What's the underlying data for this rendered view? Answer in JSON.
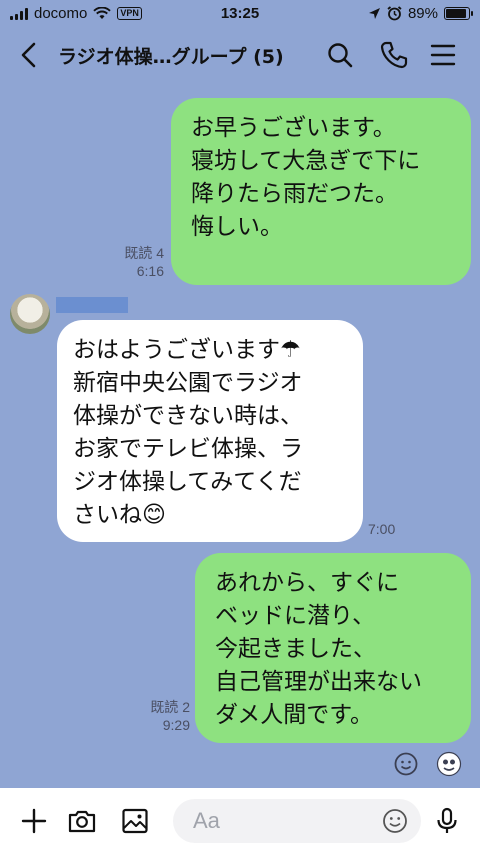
{
  "status": {
    "carrier": "docomo",
    "vpn": "VPN",
    "time": "13:25",
    "battery_pct": "89%",
    "battery_level": 0.89
  },
  "header": {
    "title": "ラジオ体操…グループ (5)"
  },
  "messages": [
    {
      "side": "me",
      "text": "お早うございます。\n寝坊して大急ぎで下に\n降りたら雨だつた。\n悔しい。",
      "read": "既読 4",
      "time": "6:16"
    },
    {
      "side": "other",
      "text": "おはようございます☂\n新宿中央公園でラジオ\n体操ができない時は、\nお家でテレビ体操、ラ\nジオ体操してみてくだ\nさいね😊",
      "time": "7:00"
    },
    {
      "side": "me",
      "text": "あれから、すぐに\nベッドに潜り、\n今起きました、\n自己管理が出来ない\nダメ人間です。",
      "read": "既読 2",
      "time": "9:29"
    }
  ],
  "input": {
    "placeholder": "Aa"
  },
  "icons": {
    "back": "chevron-left-icon",
    "search": "search-icon",
    "call": "phone-icon",
    "menu": "menu-icon",
    "add": "plus-icon",
    "camera": "camera-icon",
    "image": "image-icon",
    "emoji": "emoji-icon",
    "mic": "microphone-icon"
  },
  "colors": {
    "background": "#8fa5d3",
    "my_bubble": "#8ee180",
    "other_bubble": "#ffffff"
  }
}
